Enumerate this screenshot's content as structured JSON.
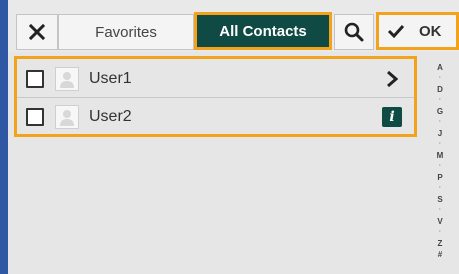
{
  "toolbar": {
    "close_icon": "x-icon",
    "favorites_label": "Favorites",
    "all_contacts_label": "All Contacts",
    "search_icon": "search-icon",
    "ok_icon": "checkmark-icon",
    "ok_label": "OK"
  },
  "contacts": [
    {
      "name": "User1",
      "trailing_icon": "chevron-right-icon"
    },
    {
      "name": "User2",
      "trailing_icon": "info-icon"
    }
  ],
  "alpha_index": [
    "A",
    "·",
    "D",
    "·",
    "G",
    "·",
    "J",
    "·",
    "M",
    "·",
    "P",
    "·",
    "S",
    "·",
    "V",
    "·",
    "Z",
    "#"
  ],
  "colors": {
    "accent_dark": "#0f4b44",
    "highlight": "#f2a31b",
    "frame": "#2f58a4"
  }
}
